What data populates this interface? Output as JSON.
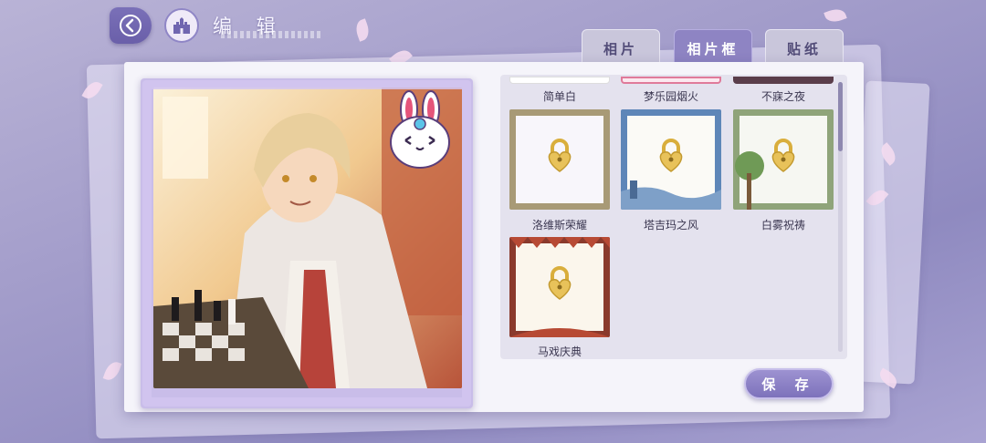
{
  "header": {
    "title": "编 辑",
    "back_icon": "back-arrow-icon",
    "home_icon": "castle-icon"
  },
  "tabs": [
    {
      "label": "相片",
      "active": false
    },
    {
      "label": "相片框",
      "active": true
    },
    {
      "label": "贴纸",
      "active": false
    }
  ],
  "top_row_labels": [
    "简单白",
    "梦乐园烟火",
    "不寐之夜"
  ],
  "frames": [
    {
      "label": "洛维斯荣耀",
      "locked": true,
      "icon": "lock-icon"
    },
    {
      "label": "塔吉玛之风",
      "locked": true,
      "icon": "lock-icon"
    },
    {
      "label": "白雾祝祷",
      "locked": true,
      "icon": "lock-icon"
    },
    {
      "label": "马戏庆典",
      "locked": true,
      "icon": "lock-icon"
    }
  ],
  "save_label": "保 存",
  "colors": {
    "accent": "#8e84c3",
    "panel": "#f5f4fa",
    "lock_gold": "#e8c25a"
  }
}
